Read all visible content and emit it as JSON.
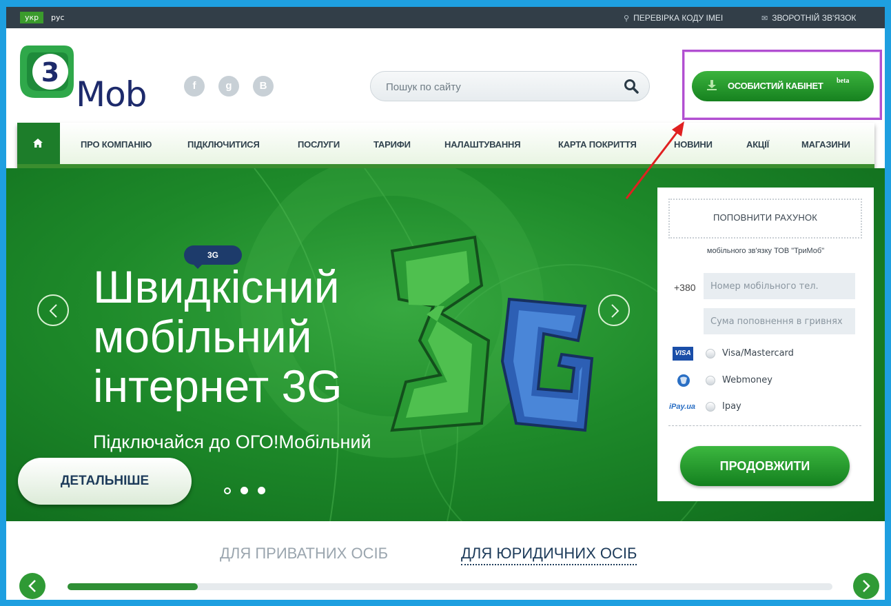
{
  "topbar": {
    "lang_ukr": "укр",
    "lang_rus": "рус",
    "imei_link": "ПЕРЕВІРКА КОДУ ІМЕІ",
    "feedback_link": "ЗВОРОТНІЙ ЗВ'ЯЗОК"
  },
  "header": {
    "logo_text": "Mob",
    "logo_digit": "3",
    "social": [
      "f",
      "g",
      "B"
    ],
    "search": {
      "placeholder": "Пошук по сайту"
    },
    "cabinet": {
      "label": "ОСОБИСТИЙ КАБІНЕТ",
      "badge": "beta"
    }
  },
  "nav": {
    "items": [
      "ПРО КОМПАНІЮ",
      "ПІДКЛЮЧИТИСЯ",
      "ПОСЛУГИ",
      "ТАРИФИ",
      "НАЛАШТУВАННЯ",
      "КАРТА ПОКРИТТЯ",
      "НОВИНИ",
      "АКЦІЇ",
      "МАГАЗИНИ"
    ]
  },
  "banner": {
    "tag": "3G",
    "headline": [
      "Швидкісний",
      "мобільний",
      "інтернет 3G"
    ],
    "subline": "Підключайся до ОГО!Мобільний",
    "more_button": "ДЕТАЛЬНІШЕ",
    "slides_total": 3,
    "slide_active": 1
  },
  "topup": {
    "title": "ПОПОВНИТИ РАХУНОК",
    "subtitle": "мобільного зв'язку ТОВ \"ТриМоб\"",
    "prefix": "+380",
    "phone_placeholder": "Номер мобільного тел.",
    "sum_placeholder": "Сума поповнення в гривнях",
    "methods": [
      {
        "logo": "VISA",
        "label": "Visa/Mastercard"
      },
      {
        "logo": "",
        "label": "Webmoney"
      },
      {
        "logo": "iPay.ua",
        "label": "Ipay"
      }
    ],
    "continue": "ПРОДОВЖИТИ"
  },
  "bottom": {
    "tab_private": "ДЛЯ ПРИВАТНИХ ОСІБ",
    "tab_legal": "ДЛЯ ЮРИДИЧНИХ ОСІБ",
    "progress_fraction": 0.17
  },
  "colors": {
    "frame": "#1e9fe0",
    "topbar": "#323e48",
    "brand_green": "#1d7d2a",
    "navy": "#1d2a6b",
    "highlight_box": "#b14fd1",
    "annotation_arrow": "#e02020"
  }
}
